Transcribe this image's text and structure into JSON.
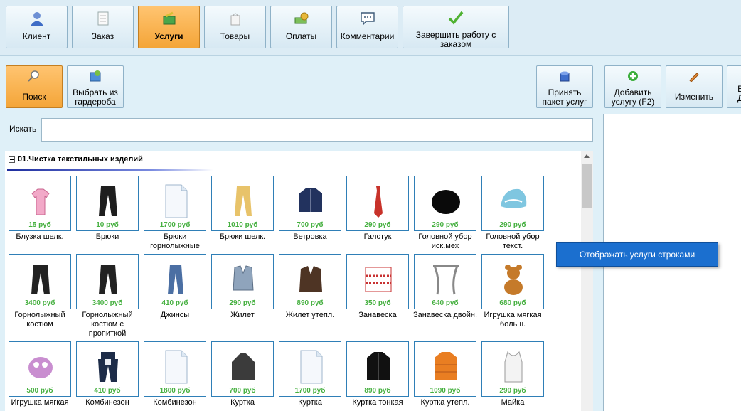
{
  "tabs": [
    {
      "label": "Клиент",
      "icon": "person-icon"
    },
    {
      "label": "Заказ",
      "icon": "document-icon"
    },
    {
      "label": "Услуги",
      "icon": "services-icon"
    },
    {
      "label": "Товары",
      "icon": "bag-icon"
    },
    {
      "label": "Оплаты",
      "icon": "money-icon"
    },
    {
      "label": "Комментарии",
      "icon": "speech-bubble-icon"
    },
    {
      "label": "Завершить работу с заказом",
      "icon": "checkmark-icon"
    }
  ],
  "active_tab": "Услуги",
  "toolbar": {
    "search": "Поиск",
    "wardrobe": "Выбрать из гардероба",
    "accept_package": "Принять пакет услуг",
    "add_service": "Добавить услугу (F2)",
    "edit": "Изменить",
    "cut_label": "В\nД"
  },
  "search": {
    "label": "Искать",
    "value": ""
  },
  "group": {
    "title": "01.Чистка текстильных изделий"
  },
  "items": [
    {
      "name": "Блузка шелк.",
      "price": "15 руб",
      "icon": "blouse-icon"
    },
    {
      "name": "Брюки",
      "price": "10 руб",
      "icon": "trousers-icon"
    },
    {
      "name": "Брюки горнолыжные",
      "price": "1700 руб",
      "icon": "blank-document-icon"
    },
    {
      "name": "Брюки шелк.",
      "price": "1010 руб",
      "icon": "silk-trousers-icon"
    },
    {
      "name": "Ветровка",
      "price": "700 руб",
      "icon": "jacket-icon"
    },
    {
      "name": "Галстук",
      "price": "290 руб",
      "icon": "tie-icon"
    },
    {
      "name": "Головной убор иск.мех",
      "price": "290 руб",
      "icon": "fur-hat-icon"
    },
    {
      "name": "Головной убор текст.",
      "price": "290 руб",
      "icon": "knit-hat-icon"
    },
    {
      "name": "Горнолыжный костюм",
      "price": "3400 руб",
      "icon": "ski-suit-icon"
    },
    {
      "name": "Горнолыжный костюм с пропиткой",
      "price": "3400 руб",
      "icon": "ski-suit-icon"
    },
    {
      "name": "Джинсы",
      "price": "410 руб",
      "icon": "jeans-icon"
    },
    {
      "name": "Жилет",
      "price": "290 руб",
      "icon": "vest-icon"
    },
    {
      "name": "Жилет утепл.",
      "price": "890 руб",
      "icon": "warm-vest-icon"
    },
    {
      "name": "Занавеска",
      "price": "350 руб",
      "icon": "curtain-icon"
    },
    {
      "name": "Занавеска двойн.",
      "price": "640 руб",
      "icon": "double-curtain-icon"
    },
    {
      "name": "Игрушка мягкая больш.",
      "price": "680 руб",
      "icon": "teddy-bear-icon"
    },
    {
      "name": "Игрушка мягкая",
      "price": "500 руб",
      "icon": "plush-toy-icon"
    },
    {
      "name": "Комбинезон",
      "price": "410 руб",
      "icon": "overalls-icon"
    },
    {
      "name": "Комбинезон",
      "price": "1800 руб",
      "icon": "blank-document-icon"
    },
    {
      "name": "Куртка",
      "price": "700 руб",
      "icon": "hoodie-icon"
    },
    {
      "name": "Куртка",
      "price": "1700 руб",
      "icon": "blank-document-icon"
    },
    {
      "name": "Куртка тонкая",
      "price": "890 руб",
      "icon": "thin-jacket-icon"
    },
    {
      "name": "Куртка утепл.",
      "price": "1090 руб",
      "icon": "down-jacket-icon"
    },
    {
      "name": "Майка",
      "price": "290 руб",
      "icon": "tank-top-icon"
    }
  ],
  "context_menu": {
    "item": "Отображать услуги строками"
  }
}
